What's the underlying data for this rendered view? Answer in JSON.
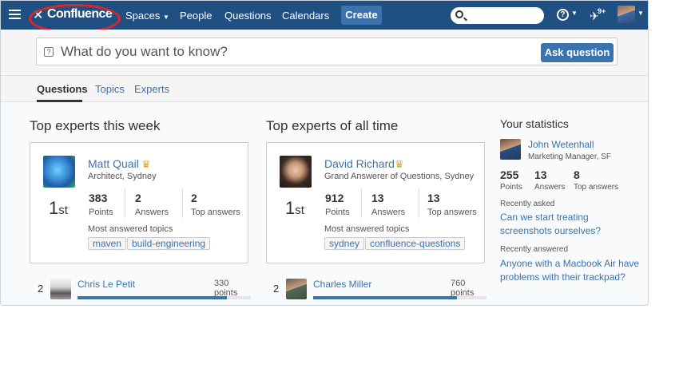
{
  "nav": {
    "logo": "Confluence",
    "spaces": "Spaces",
    "people": "People",
    "questions": "Questions",
    "calendars": "Calendars",
    "create": "Create",
    "help_symbol": "?",
    "notification_badge": "9+"
  },
  "ask": {
    "placeholder": "What do you want to know?",
    "button": "Ask question"
  },
  "tabs": [
    "Questions",
    "Topics",
    "Experts"
  ],
  "week": {
    "title": "Top experts this week",
    "expert": {
      "name": "Matt Quail",
      "role": "Architect, Sydney",
      "rank": "1",
      "rank_suffix": "st",
      "points": "383",
      "answers": "2",
      "top_answers": "2",
      "topics_label": "Most answered topics",
      "topics": [
        "maven",
        "build-engineering"
      ]
    },
    "runner_up": {
      "rank": "2",
      "name": "Chris Le Petit",
      "points": "330 points",
      "progress": 0.86
    }
  },
  "alltime": {
    "title": "Top experts of all time",
    "expert": {
      "name": "David Richard",
      "role": "Grand Answerer of Questions, Sydney",
      "rank": "1",
      "rank_suffix": "st",
      "points": "912",
      "answers": "13",
      "top_answers": "13",
      "topics_label": "Most answered topics",
      "topics": [
        "sydney",
        "confluence-questions"
      ]
    },
    "runner_up": {
      "rank": "2",
      "name": "Charles Miller",
      "points": "760 points",
      "progress": 0.83
    }
  },
  "labels": {
    "points": "Points",
    "answers": "Answers",
    "top_answers": "Top answers"
  },
  "stats": {
    "title": "Your statistics",
    "name": "John Wetenhall",
    "role": "Marketing Manager, SF",
    "points": "255",
    "answers": "13",
    "top_answers": "8",
    "recently_asked_label": "Recently asked",
    "recently_asked": "Can we start treating screenshots ourselves?",
    "recently_answered_label": "Recently answered",
    "recently_answered": "Anyone with a Macbook Air have problems with their trackpad?"
  },
  "colors": {
    "header": "#205081",
    "accent": "#3b73af",
    "crown": "#d4a72c",
    "highlight_ring": "#e0242a"
  }
}
